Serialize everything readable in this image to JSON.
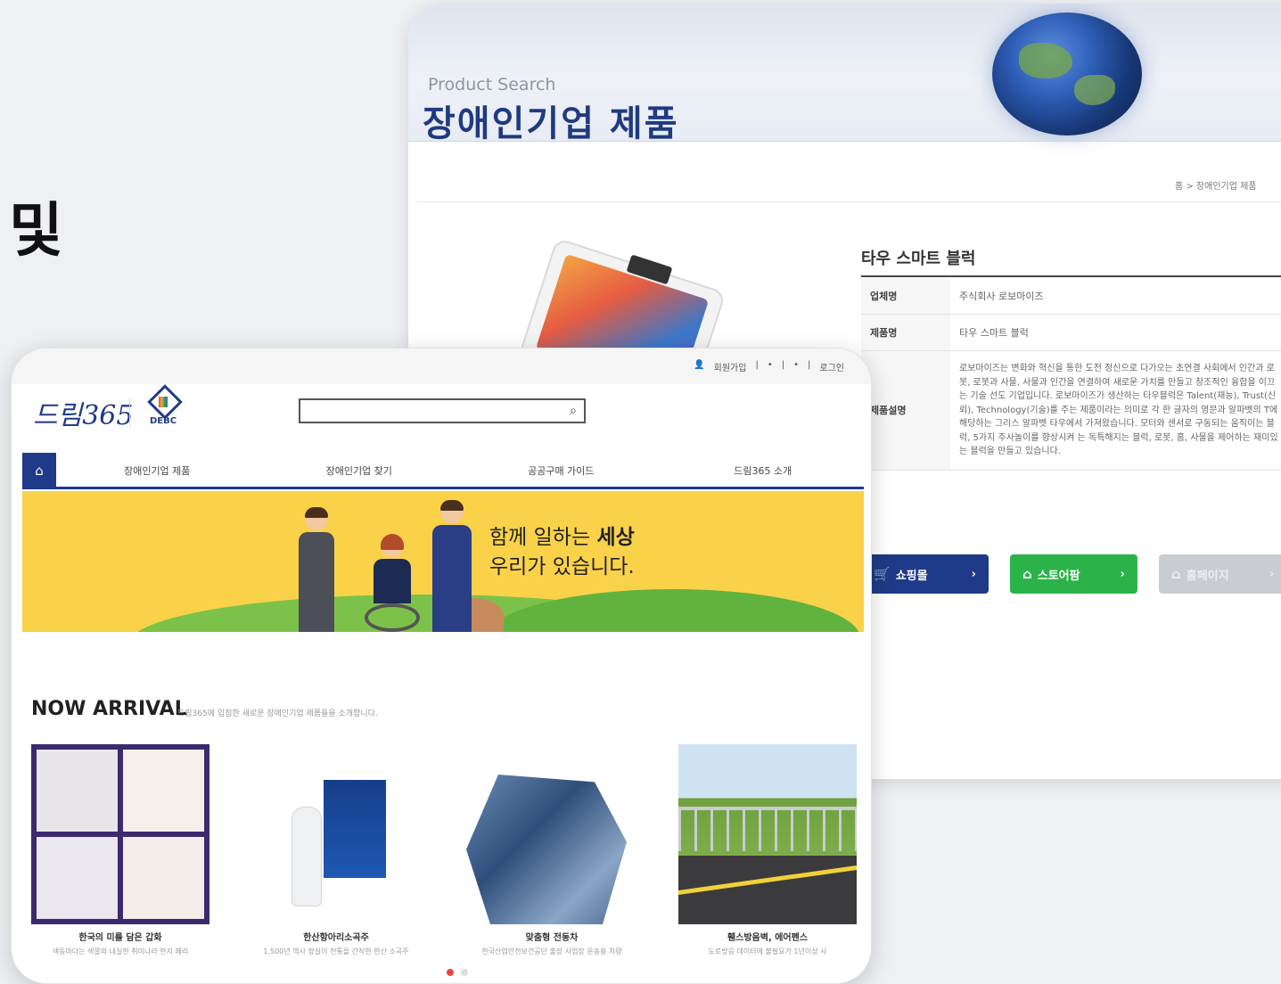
{
  "side_text": "및",
  "product_page": {
    "banner_subtitle": "Product Search",
    "banner_title": "장애인기업 제품",
    "breadcrumb": "홈 > 장애인기업 제품",
    "product_title": "타우 스마트 블럭",
    "specs": [
      {
        "label": "업체명",
        "value": "주식회사 로보마이즈"
      },
      {
        "label": "제품명",
        "value": "타우 스마트 블럭"
      },
      {
        "label": "제품설명",
        "value": "로보마이즈는 변화와 혁신을 통한 도전 정신으로 다가오는 초연결 사회에서 인간과 로봇, 로봇과 사물, 사물과 인간을 연결하여 새로운 가치를 만들고 창조적인 융합을 이끄는 기술 선도 기업입니다. 로보마이즈가 생산하는 타우블럭은 Talent(재능), Trust(신뢰), Technology(기술)를 주는 제품이라는 의미로 각 한 글자의 영문과 알파벳의 T에 해당하는 그리스 알파벳 타우에서 가져왔습니다. 모터와 센서로 구동되는 움직이는 블럭, 5가지 주사놀이를 향상시켜 는 독특해지는 블럭, 로봇, 홈, 사물을 제어하는 재미있는 블럭을 만들고 있습니다."
      }
    ],
    "buttons": [
      {
        "label": "쇼핑몰",
        "icon": "cart-icon",
        "color": "#1f3a88"
      },
      {
        "label": "스토어팜",
        "icon": "store-icon",
        "color": "#2bb34a"
      },
      {
        "label": "홈페이지",
        "icon": "home-icon",
        "color": "#c9ccd1"
      }
    ]
  },
  "home_page": {
    "util_links": [
      "회원가입",
      "|",
      "•",
      "|",
      "•",
      "|",
      "로그인"
    ],
    "logo": "드림365",
    "debc": "DEBC",
    "search_placeholder": "",
    "nav": [
      "장애인기업 제품",
      "장애인기업 찾기",
      "공공구매 가이드",
      "드림365 소개"
    ],
    "hero_line1": "함께 일하는 ",
    "hero_line1_bold": "세상",
    "hero_line2": "우리가 있습니다.",
    "arrival_title": "NOW ARRIVAL",
    "arrival_sub": "드림365에 입점한 새로운 장애인기업 제품들을 소개합니다.",
    "products": [
      {
        "name": "한국의 미를 담은 갑화",
        "desc": "색동마다는 색깔의 내실한 취미나라 한지 페리"
      },
      {
        "name": "한산항아리소곡주",
        "desc": "1,500년 역사 향실이 전통을 간직한 한산 소곡주"
      },
      {
        "name": "맞춤형 전동차",
        "desc": "한국산업안전보건공단 출장 사업장 운송용 차량"
      },
      {
        "name": "휀스방음벽, 에어펜스",
        "desc": "도로방음 데이터에 불필요가 1년이상 사"
      }
    ]
  }
}
